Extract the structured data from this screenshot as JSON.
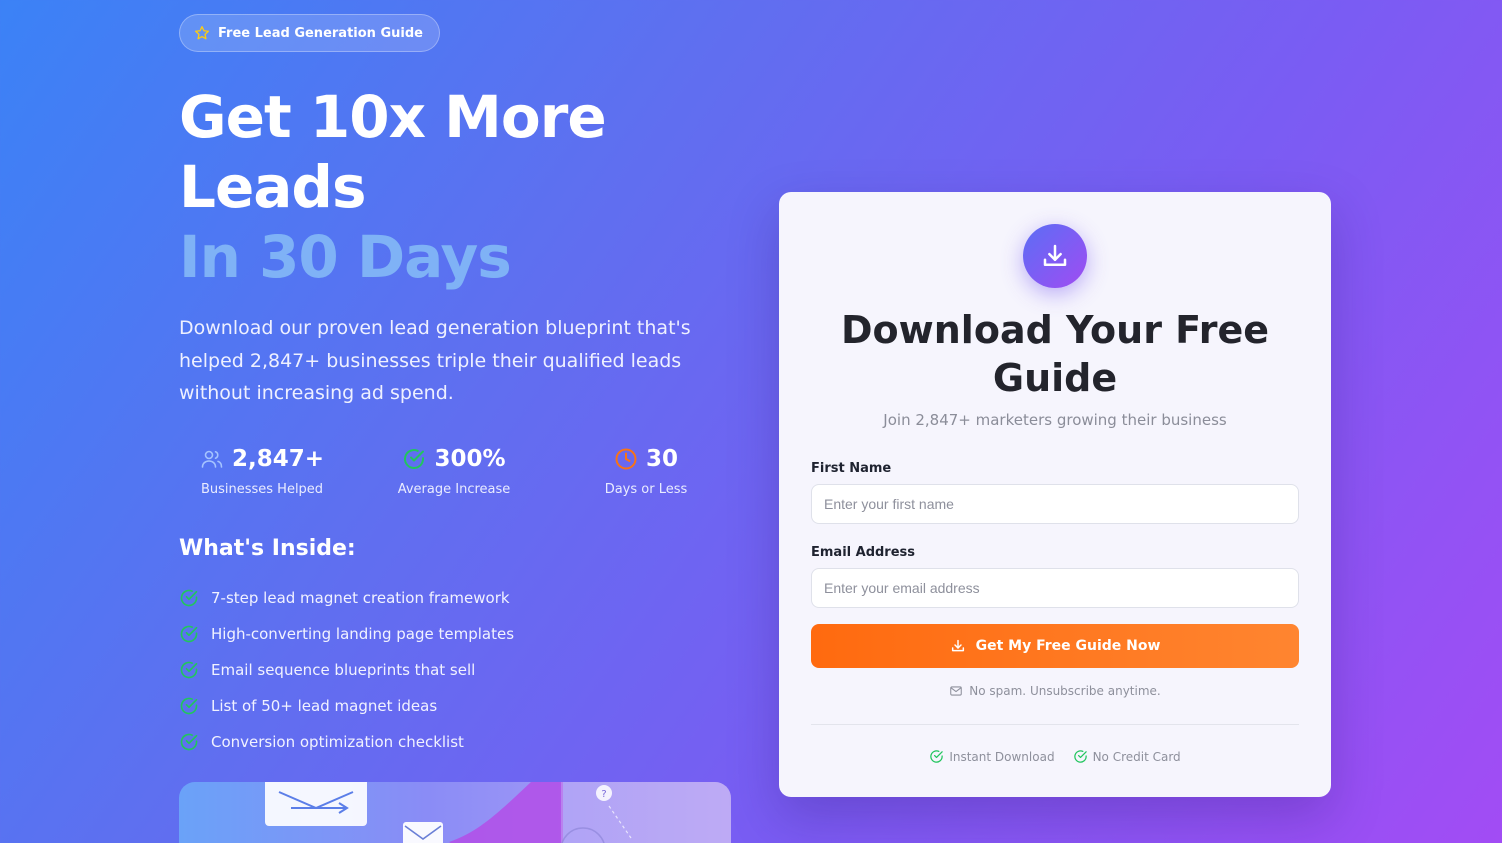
{
  "badge": {
    "icon": "star-icon",
    "label": "Free Lead Generation Guide"
  },
  "hero": {
    "line1": "Get 10x More",
    "line2": "Leads",
    "line3": "In 30 Days",
    "description": "Download our proven lead generation blueprint that's helped 2,847+ businesses triple their qualified leads without increasing ad spend."
  },
  "stats": [
    {
      "icon": "users-icon",
      "value": "2,847+",
      "label": "Businesses Helped"
    },
    {
      "icon": "check-circle-icon",
      "value": "300%",
      "label": "Average Increase"
    },
    {
      "icon": "clock-icon",
      "value": "30",
      "label": "Days or Less"
    }
  ],
  "inside": {
    "title": "What's Inside:",
    "items": [
      "7-step lead magnet creation framework",
      "High-converting landing page templates",
      "Email sequence blueprints that sell",
      "List of 50+ lead magnet ideas",
      "Conversion optimization checklist"
    ]
  },
  "form": {
    "icon": "download-icon",
    "title": "Download Your Free Guide",
    "subtitle": "Join 2,847+ marketers growing their business",
    "first_name_label": "First Name",
    "first_name_placeholder": "Enter your first name",
    "first_name_value": "",
    "email_label": "Email Address",
    "email_placeholder": "Enter your email address",
    "email_value": "",
    "submit_label": "Get My Free Guide Now",
    "no_spam": "No spam. Unsubscribe anytime.",
    "trust": [
      "Instant Download",
      "No Credit Card"
    ]
  },
  "colors": {
    "accent_orange": "#ff6a0f",
    "success_green": "#22c55e",
    "highlight_blue": "#7fb2f6",
    "clock_orange": "#f97316"
  }
}
